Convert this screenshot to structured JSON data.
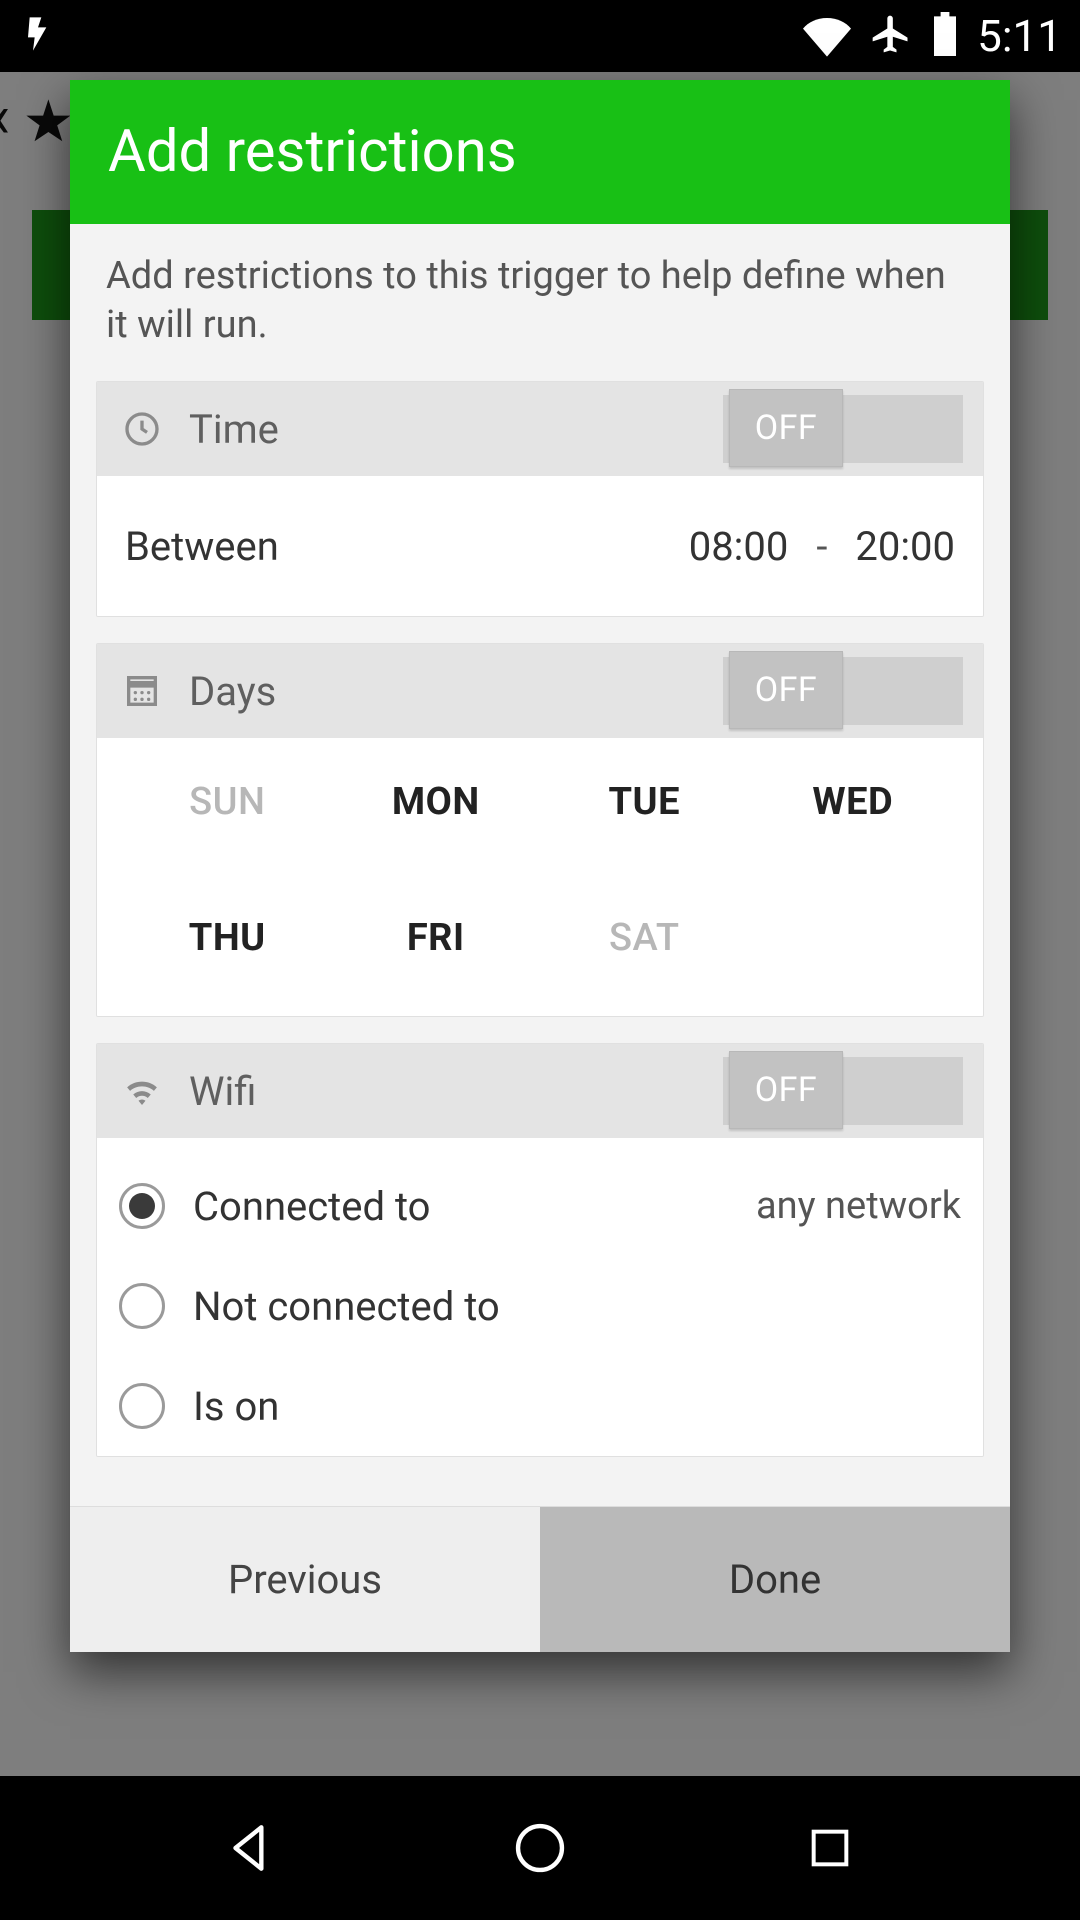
{
  "statusbar": {
    "time": "5:11"
  },
  "dialog": {
    "title": "Add restrictions",
    "description": "Add restrictions to this trigger to help define when it will run."
  },
  "time": {
    "header": "Time",
    "toggle": "OFF",
    "between_label": "Between",
    "start": "08:00",
    "sep": "-",
    "end": "20:00"
  },
  "days": {
    "header": "Days",
    "toggle": "OFF",
    "items": [
      {
        "label": "SUN",
        "selected": false
      },
      {
        "label": "MON",
        "selected": true
      },
      {
        "label": "TUE",
        "selected": true
      },
      {
        "label": "WED",
        "selected": true
      },
      {
        "label": "THU",
        "selected": true
      },
      {
        "label": "FRI",
        "selected": true
      },
      {
        "label": "SAT",
        "selected": false
      }
    ]
  },
  "wifi": {
    "header": "Wifi",
    "toggle": "OFF",
    "options": [
      {
        "label": "Connected to",
        "checked": true,
        "value": "any network"
      },
      {
        "label": "Not connected to",
        "checked": false
      },
      {
        "label": "Is on",
        "checked": false
      }
    ]
  },
  "footer": {
    "previous": "Previous",
    "done": "Done"
  }
}
